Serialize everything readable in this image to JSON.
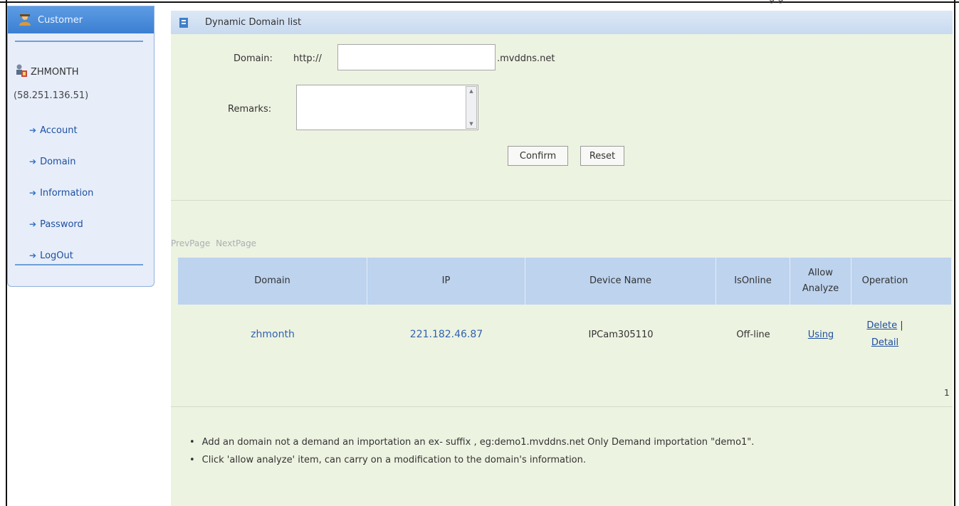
{
  "page": {
    "top_clip_text": "g                                           g"
  },
  "sidebar": {
    "title": "Customer",
    "user_name": "ZHMONTH",
    "user_ip": "(58.251.136.51)",
    "nav": [
      {
        "label": "Account"
      },
      {
        "label": "Domain"
      },
      {
        "label": "Information"
      },
      {
        "label": "Password"
      },
      {
        "label": "LogOut"
      }
    ]
  },
  "main": {
    "title": "Dynamic Domain list",
    "form": {
      "domain_label": "Domain:",
      "domain_prefix": "http://",
      "domain_value": "",
      "domain_suffix": ".mvddns.net",
      "remarks_label": "Remarks:",
      "remarks_value": "",
      "confirm_label": "Confirm",
      "reset_label": "Reset"
    },
    "pager": {
      "prev": "PrevPage",
      "next": "NextPage"
    },
    "table": {
      "columns": [
        "Domain",
        "IP",
        "Device Name",
        "IsOnline",
        "Allow Analyze",
        "Operation"
      ],
      "rows": [
        {
          "domain": "zhmonth",
          "ip": "221.182.46.87",
          "device_name": "IPCam305110",
          "is_online": "Off-line",
          "allow_analyze": "Using",
          "op_delete": "Delete",
          "op_sep": "|",
          "op_detail": "Detail"
        }
      ]
    },
    "page_number": "1",
    "notes": [
      "Add an domain not a demand an importation an ex- suffix , eg:demo1.mvddns.net Only Demand importation \"demo1\".",
      "Click 'allow analyze' item, can carry on a modification to the domain's information."
    ]
  }
}
